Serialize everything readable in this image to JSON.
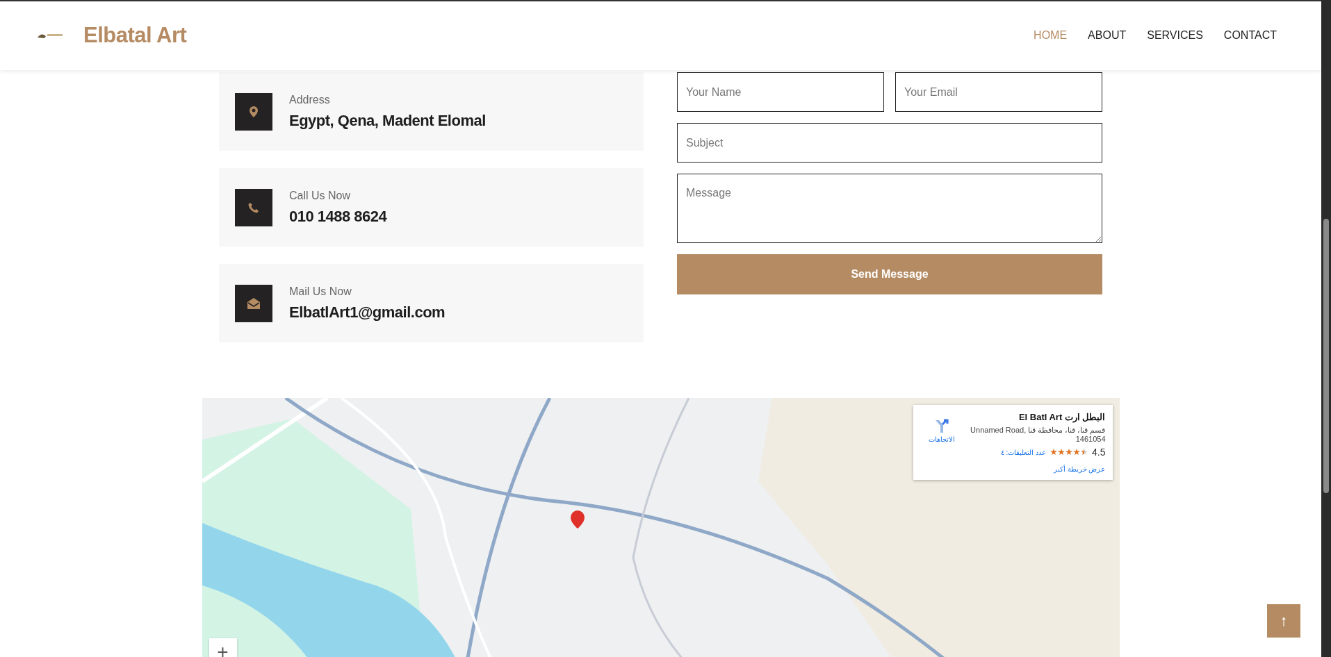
{
  "header": {
    "brand": "Elbatal Art",
    "nav": [
      {
        "label": "HOME",
        "selected": true
      },
      {
        "label": "ABOUT",
        "selected": false
      },
      {
        "label": "SERVICES",
        "selected": false
      },
      {
        "label": "CONTACT",
        "selected": false
      }
    ]
  },
  "contact_cards": [
    {
      "kind": "address",
      "label": "Address",
      "value": "Egypt, Qena, Madent Elomal"
    },
    {
      "kind": "phone",
      "label": "Call Us Now",
      "value": "010 1488 8624"
    },
    {
      "kind": "mail",
      "label": "Mail Us Now",
      "value": "ElbatlArt1@gmail.com"
    }
  ],
  "form": {
    "name": {
      "placeholder": "Your Name"
    },
    "email": {
      "placeholder": "Your Email"
    },
    "subject": {
      "placeholder": "Subject"
    },
    "message": {
      "placeholder": "Message"
    },
    "submit": "Send Message"
  },
  "map": {
    "place_card": {
      "title": "El Batl Art البطل ارت",
      "address": "Unnamed Road, قسم قنا، قنا، محافظة قنا 1461054",
      "directions": "الاتجاهات",
      "rating": "4.5",
      "stars": 4.5,
      "reviews": "عدد التعليقات: ٤",
      "larger_map": "عرض خريطة أكبر"
    },
    "zoom_in": "+"
  },
  "scroll_top": "↑"
}
